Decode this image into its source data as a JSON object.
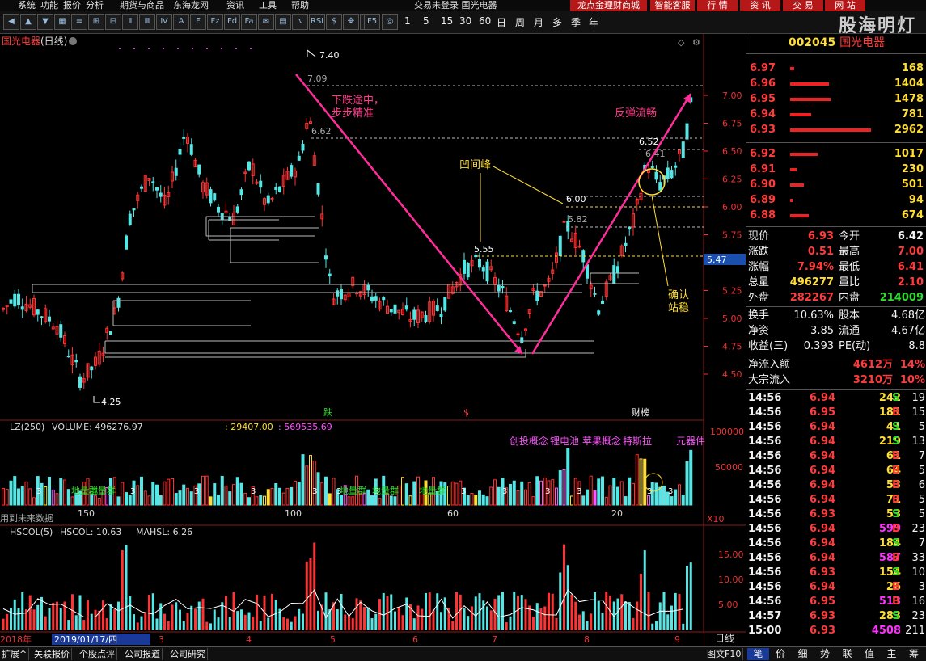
{
  "menu": {
    "items": [
      "系统",
      "功能",
      "报价",
      "分析",
      "期货与商品",
      "东海龙网",
      "资讯",
      "工具",
      "帮助"
    ],
    "center_title": "交易未登录  国光电器",
    "right_buttons": [
      "龙点金理财商城",
      "智能客服",
      "行 情",
      "资 讯",
      "交 易",
      "网 站"
    ]
  },
  "watermark": "股海明灯",
  "toolbar": {
    "periods": [
      "1",
      "5",
      "15",
      "30",
      "60",
      "日",
      "周",
      "月",
      "多",
      "季",
      "年"
    ]
  },
  "kline": {
    "stock_name": "国光电器",
    "period_label": "(日线)",
    "price_labels": [
      "7.00",
      "6.75",
      "6.50",
      "6.25",
      "6.00",
      "5.75",
      "5.25",
      "5.00",
      "4.75",
      "4.50"
    ],
    "current_price_tag": "5.47",
    "marks": {
      "high": "7.40",
      "h2": "7.09",
      "h3": "6.62",
      "m1": "6.52",
      "m2": "6.41",
      "m3": "6.00",
      "m4": "5.82",
      "m5": "5.55",
      "low": "4.25"
    },
    "annotations": {
      "falling": "下跌途中，\n步步精准",
      "rebound": "反弹流畅",
      "peak": "凹间峰",
      "confirm": "确认\n站稳"
    },
    "event_marks": [
      "跌",
      "$",
      "财榜"
    ]
  },
  "lz": {
    "title": "LZ(250)",
    "volume_label": "VOLUME: 496276.97",
    "v2": ": 29407.00",
    "v3": ": 569535.69",
    "y_labels": [
      "100000",
      "50000"
    ],
    "concept_labels": [
      "创投概念",
      "锂电池",
      "苹果概念",
      "特斯拉",
      "元器件"
    ],
    "group_labels": [
      "地量群",
      "地量群",
      "地量群",
      "地量群",
      "地量群"
    ],
    "x_labels": [
      "150",
      "100",
      "60",
      "20"
    ],
    "x10": "X10",
    "footer": "用到未来数据"
  },
  "hscol": {
    "title": "HSCOL(5)",
    "hscol_val": "HSCOL: 10.63",
    "mahsl_val": "MAHSL: 6.26",
    "y_labels": [
      "15.00",
      "10.00",
      "5.00"
    ]
  },
  "dates": {
    "year": "2018年",
    "cursor_date": "2019/01/17/四",
    "months": [
      "3",
      "4",
      "5",
      "6",
      "7",
      "8",
      "9"
    ],
    "period_button": "日线"
  },
  "quote": {
    "code": "002045",
    "name": "国光电器",
    "asks": [
      {
        "price": "6.97",
        "vol": "168",
        "bar": 0.05
      },
      {
        "price": "6.96",
        "vol": "1404",
        "bar": 0.48
      },
      {
        "price": "6.95",
        "vol": "1478",
        "bar": 0.5
      },
      {
        "price": "6.94",
        "vol": "781",
        "bar": 0.26
      },
      {
        "price": "6.93",
        "vol": "2962",
        "bar": 1.0
      }
    ],
    "bids": [
      {
        "price": "6.92",
        "vol": "1017",
        "bar": 0.34
      },
      {
        "price": "6.91",
        "vol": "230",
        "bar": 0.08
      },
      {
        "price": "6.90",
        "vol": "501",
        "bar": 0.17
      },
      {
        "price": "6.89",
        "vol": "94",
        "bar": 0.03
      },
      {
        "price": "6.88",
        "vol": "674",
        "bar": 0.23
      }
    ],
    "stats": [
      {
        "l1": "现价",
        "v1": "6.93",
        "c1": "red",
        "l2": "今开",
        "v2": "6.42",
        "c2": "white"
      },
      {
        "l1": "涨跌",
        "v1": "0.51",
        "c1": "red",
        "l2": "最高",
        "v2": "7.00",
        "c2": "red"
      },
      {
        "l1": "涨幅",
        "v1": "7.94%",
        "c1": "red",
        "l2": "最低",
        "v2": "6.41",
        "c2": "red"
      },
      {
        "l1": "总量",
        "v1": "496277",
        "c1": "yellow",
        "l2": "量比",
        "v2": "2.10",
        "c2": "red"
      },
      {
        "l1": "外盘",
        "v1": "282267",
        "c1": "red",
        "l2": "内盘",
        "v2": "214009",
        "c2": "green"
      }
    ],
    "stats2": [
      {
        "l1": "换手",
        "v1": "10.63%",
        "l2": "股本",
        "v2": "4.68亿"
      },
      {
        "l1": "净资",
        "v1": "3.85",
        "l2": "流通",
        "v2": "4.67亿"
      },
      {
        "l1": "收益(三)",
        "v1": "0.393",
        "l2": "PE(动)",
        "v2": "8.8"
      }
    ],
    "flows": [
      {
        "label": "净流入额",
        "v1": "4612万",
        "v2": "14%"
      },
      {
        "label": "大宗流入",
        "v1": "3210万",
        "v2": "10%"
      }
    ],
    "ticks": [
      {
        "t": "14:56",
        "p": "6.94",
        "v": "242",
        "s": "S",
        "n": "19",
        "vc": "yellow"
      },
      {
        "t": "14:56",
        "p": "6.95",
        "v": "181",
        "s": "B",
        "n": "15",
        "vc": "yellow"
      },
      {
        "t": "14:56",
        "p": "6.94",
        "v": "41",
        "s": "S",
        "n": "5",
        "vc": "yellow"
      },
      {
        "t": "14:56",
        "p": "6.94",
        "v": "219",
        "s": "S",
        "n": "13",
        "vc": "yellow"
      },
      {
        "t": "14:56",
        "p": "6.94",
        "v": "61",
        "s": "B",
        "n": "7",
        "vc": "yellow"
      },
      {
        "t": "14:56",
        "p": "6.94",
        "v": "64",
        "s": "B",
        "n": "5",
        "vc": "yellow"
      },
      {
        "t": "14:56",
        "p": "6.94",
        "v": "53",
        "s": "B",
        "n": "6",
        "vc": "yellow"
      },
      {
        "t": "14:56",
        "p": "6.94",
        "v": "71",
        "s": "B",
        "n": "5",
        "vc": "yellow"
      },
      {
        "t": "14:56",
        "p": "6.93",
        "v": "53",
        "s": "S",
        "n": "5",
        "vc": "yellow"
      },
      {
        "t": "14:56",
        "p": "6.94",
        "v": "599",
        "s": "B",
        "n": "23",
        "vc": "magenta"
      },
      {
        "t": "14:56",
        "p": "6.94",
        "v": "184",
        "s": "S",
        "n": "7",
        "vc": "yellow"
      },
      {
        "t": "14:56",
        "p": "6.94",
        "v": "587",
        "s": "B",
        "n": "33",
        "vc": "magenta"
      },
      {
        "t": "14:56",
        "p": "6.93",
        "v": "154",
        "s": "S",
        "n": "10",
        "vc": "yellow"
      },
      {
        "t": "14:56",
        "p": "6.94",
        "v": "26",
        "s": "B",
        "n": "3",
        "vc": "yellow"
      },
      {
        "t": "14:56",
        "p": "6.95",
        "v": "513",
        "s": "B",
        "n": "16",
        "vc": "magenta"
      },
      {
        "t": "14:57",
        "p": "6.93",
        "v": "283",
        "s": "S",
        "n": "23",
        "vc": "yellow"
      },
      {
        "t": "15:00",
        "p": "6.93",
        "v": "4508",
        "s": "",
        "n": "211",
        "vc": "magenta"
      }
    ]
  },
  "bottom_tabs": [
    "扩展^",
    "关联报价",
    "个股点评",
    "公司报道",
    "公司研究"
  ],
  "right_tabs": [
    "图文F10",
    "笔",
    "价",
    "细",
    "势",
    "联",
    "值",
    "主",
    "筹"
  ]
}
